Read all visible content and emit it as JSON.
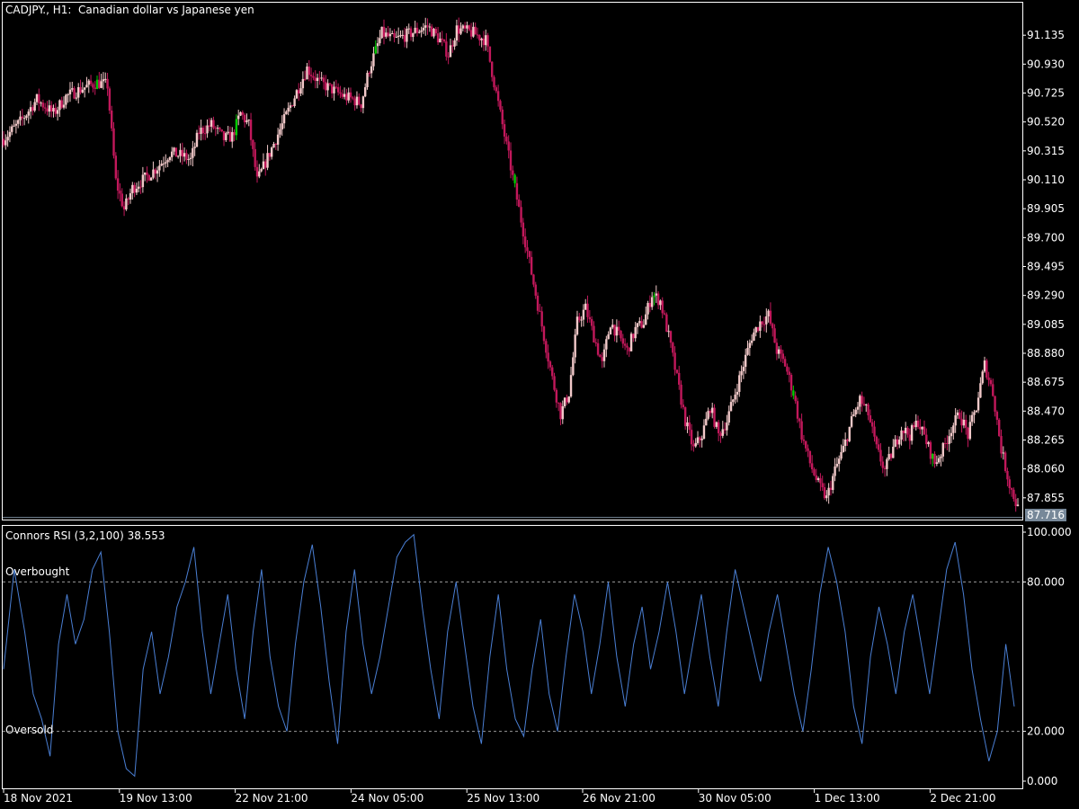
{
  "header": {
    "symbol": "CADJPY.",
    "timeframe": "H1:",
    "description": "Canadian dollar vs Japanese yen"
  },
  "indicator": {
    "name": "Connors RSI (3,2,100)",
    "value": "38.553",
    "levels": [
      {
        "label": "Overbought",
        "value": 80
      },
      {
        "label": "Oversold",
        "value": 20
      }
    ]
  },
  "colors": {
    "background": "#000000",
    "bull_candle": "#f2c9c9",
    "bear_candle": "#c2185b",
    "doji_candle": "#00c800",
    "rsi_line": "#4a7fd4",
    "grid_border": "#ffffff",
    "price_tag": "#778899"
  },
  "price_axis": {
    "ticks": [
      "91.135",
      "90.930",
      "90.725",
      "90.520",
      "90.315",
      "90.110",
      "89.905",
      "89.700",
      "89.495",
      "89.290",
      "89.085",
      "88.880",
      "88.675",
      "88.470",
      "88.265",
      "88.060",
      "87.855"
    ],
    "current_price_label": "87.716",
    "current_price": 87.716
  },
  "rsi_axis": {
    "ticks": [
      "100.000",
      "80.000",
      "20.000",
      "0.000"
    ]
  },
  "time_axis": {
    "labels": [
      "18 Nov 2021",
      "19 Nov 13:00",
      "22 Nov 21:00",
      "24 Nov 05:00",
      "25 Nov 13:00",
      "26 Nov 21:00",
      "30 Nov 05:00",
      "1 Dec 13:00",
      "2 Dec 21:00"
    ]
  },
  "chart_data": [
    {
      "type": "candlestick",
      "ylim": [
        87.72,
        91.27
      ],
      "price_path": [
        [
          0,
          90.4
        ],
        [
          8,
          90.52
        ],
        [
          16,
          90.68
        ],
        [
          24,
          90.58
        ],
        [
          30,
          90.7
        ],
        [
          38,
          90.76
        ],
        [
          45,
          90.8
        ],
        [
          50,
          90.78
        ],
        [
          54,
          90.1
        ],
        [
          58,
          89.9
        ],
        [
          62,
          90.05
        ],
        [
          68,
          90.12
        ],
        [
          74,
          90.2
        ],
        [
          80,
          90.3
        ],
        [
          86,
          90.28
        ],
        [
          90,
          90.25
        ],
        [
          94,
          90.45
        ],
        [
          100,
          90.5
        ],
        [
          106,
          90.4
        ],
        [
          110,
          90.42
        ],
        [
          114,
          90.58
        ],
        [
          118,
          90.5
        ],
        [
          122,
          90.1
        ],
        [
          128,
          90.3
        ],
        [
          134,
          90.5
        ],
        [
          140,
          90.7
        ],
        [
          146,
          90.9
        ],
        [
          152,
          90.8
        ],
        [
          158,
          90.75
        ],
        [
          164,
          90.7
        ],
        [
          168,
          90.68
        ],
        [
          172,
          90.65
        ],
        [
          176,
          90.9
        ],
        [
          182,
          91.15
        ],
        [
          188,
          91.1
        ],
        [
          196,
          91.15
        ],
        [
          204,
          91.2
        ],
        [
          210,
          91.1
        ],
        [
          214,
          91.0
        ],
        [
          218,
          91.18
        ],
        [
          226,
          91.15
        ],
        [
          232,
          91.1
        ],
        [
          236,
          90.8
        ],
        [
          240,
          90.5
        ],
        [
          244,
          90.2
        ],
        [
          248,
          89.9
        ],
        [
          252,
          89.6
        ],
        [
          256,
          89.3
        ],
        [
          260,
          89.0
        ],
        [
          264,
          88.7
        ],
        [
          268,
          88.45
        ],
        [
          272,
          88.6
        ],
        [
          276,
          89.1
        ],
        [
          280,
          89.2
        ],
        [
          284,
          89.0
        ],
        [
          288,
          88.8
        ],
        [
          292,
          89.1
        ],
        [
          296,
          89.0
        ],
        [
          300,
          88.9
        ],
        [
          304,
          89.05
        ],
        [
          308,
          89.1
        ],
        [
          312,
          89.3
        ],
        [
          316,
          89.25
        ],
        [
          320,
          89.0
        ],
        [
          324,
          88.7
        ],
        [
          328,
          88.4
        ],
        [
          332,
          88.2
        ],
        [
          336,
          88.3
        ],
        [
          340,
          88.5
        ],
        [
          344,
          88.3
        ],
        [
          348,
          88.4
        ],
        [
          352,
          88.6
        ],
        [
          356,
          88.8
        ],
        [
          360,
          89.0
        ],
        [
          364,
          89.1
        ],
        [
          368,
          89.15
        ],
        [
          372,
          88.9
        ],
        [
          376,
          88.8
        ],
        [
          380,
          88.6
        ],
        [
          384,
          88.3
        ],
        [
          388,
          88.1
        ],
        [
          392,
          87.95
        ],
        [
          396,
          87.85
        ],
        [
          400,
          88.05
        ],
        [
          404,
          88.2
        ],
        [
          408,
          88.4
        ],
        [
          412,
          88.55
        ],
        [
          416,
          88.45
        ],
        [
          420,
          88.2
        ],
        [
          424,
          88.05
        ],
        [
          428,
          88.2
        ],
        [
          432,
          88.35
        ],
        [
          436,
          88.3
        ],
        [
          440,
          88.4
        ],
        [
          444,
          88.25
        ],
        [
          448,
          88.1
        ],
        [
          452,
          88.2
        ],
        [
          456,
          88.35
        ],
        [
          460,
          88.45
        ],
        [
          464,
          88.3
        ],
        [
          468,
          88.5
        ],
        [
          472,
          88.8
        ],
        [
          476,
          88.6
        ],
        [
          480,
          88.2
        ],
        [
          484,
          87.95
        ],
        [
          488,
          87.78
        ]
      ]
    },
    {
      "type": "line",
      "series": [
        {
          "name": "Connors RSI (3,2,100)",
          "path": [
            [
              0,
              45
            ],
            [
              5,
              85
            ],
            [
              10,
              60
            ],
            [
              14,
              35
            ],
            [
              18,
              25
            ],
            [
              22,
              10
            ],
            [
              26,
              55
            ],
            [
              30,
              75
            ],
            [
              34,
              55
            ],
            [
              38,
              65
            ],
            [
              42,
              85
            ],
            [
              46,
              92
            ],
            [
              50,
              60
            ],
            [
              54,
              20
            ],
            [
              58,
              5
            ],
            [
              62,
              2
            ],
            [
              66,
              45
            ],
            [
              70,
              60
            ],
            [
              74,
              35
            ],
            [
              78,
              50
            ],
            [
              82,
              70
            ],
            [
              86,
              80
            ],
            [
              90,
              94
            ],
            [
              94,
              60
            ],
            [
              98,
              35
            ],
            [
              102,
              55
            ],
            [
              106,
              75
            ],
            [
              110,
              45
            ],
            [
              114,
              25
            ],
            [
              118,
              60
            ],
            [
              122,
              85
            ],
            [
              126,
              50
            ],
            [
              130,
              30
            ],
            [
              134,
              20
            ],
            [
              138,
              55
            ],
            [
              142,
              80
            ],
            [
              146,
              95
            ],
            [
              150,
              70
            ],
            [
              154,
              40
            ],
            [
              158,
              15
            ],
            [
              162,
              60
            ],
            [
              166,
              85
            ],
            [
              170,
              55
            ],
            [
              174,
              35
            ],
            [
              178,
              50
            ],
            [
              182,
              70
            ],
            [
              186,
              90
            ],
            [
              190,
              96
            ],
            [
              194,
              99
            ],
            [
              198,
              70
            ],
            [
              202,
              45
            ],
            [
              206,
              25
            ],
            [
              210,
              60
            ],
            [
              214,
              80
            ],
            [
              218,
              55
            ],
            [
              222,
              30
            ],
            [
              226,
              15
            ],
            [
              230,
              50
            ],
            [
              234,
              75
            ],
            [
              238,
              45
            ],
            [
              242,
              25
            ],
            [
              246,
              18
            ],
            [
              250,
              45
            ],
            [
              254,
              65
            ],
            [
              258,
              35
            ],
            [
              262,
              20
            ],
            [
              266,
              50
            ],
            [
              270,
              75
            ],
            [
              274,
              60
            ],
            [
              278,
              35
            ],
            [
              282,
              55
            ],
            [
              286,
              80
            ],
            [
              290,
              50
            ],
            [
              294,
              30
            ],
            [
              298,
              55
            ],
            [
              302,
              70
            ],
            [
              306,
              45
            ],
            [
              310,
              60
            ],
            [
              314,
              80
            ],
            [
              318,
              60
            ],
            [
              322,
              35
            ],
            [
              326,
              55
            ],
            [
              330,
              75
            ],
            [
              334,
              50
            ],
            [
              338,
              30
            ],
            [
              342,
              60
            ],
            [
              346,
              85
            ],
            [
              350,
              70
            ],
            [
              354,
              55
            ],
            [
              358,
              40
            ],
            [
              362,
              60
            ],
            [
              366,
              75
            ],
            [
              370,
              55
            ],
            [
              374,
              35
            ],
            [
              378,
              20
            ],
            [
              382,
              45
            ],
            [
              386,
              75
            ],
            [
              390,
              94
            ],
            [
              394,
              80
            ],
            [
              398,
              60
            ],
            [
              402,
              30
            ],
            [
              406,
              15
            ],
            [
              410,
              50
            ],
            [
              414,
              70
            ],
            [
              418,
              55
            ],
            [
              422,
              35
            ],
            [
              426,
              60
            ],
            [
              430,
              75
            ],
            [
              434,
              55
            ],
            [
              438,
              35
            ],
            [
              442,
              60
            ],
            [
              446,
              85
            ],
            [
              450,
              96
            ],
            [
              454,
              75
            ],
            [
              458,
              45
            ],
            [
              462,
              25
            ],
            [
              466,
              8
            ],
            [
              470,
              20
            ],
            [
              474,
              55
            ],
            [
              478,
              30
            ]
          ]
        }
      ],
      "ylim": [
        0,
        100
      ]
    }
  ]
}
